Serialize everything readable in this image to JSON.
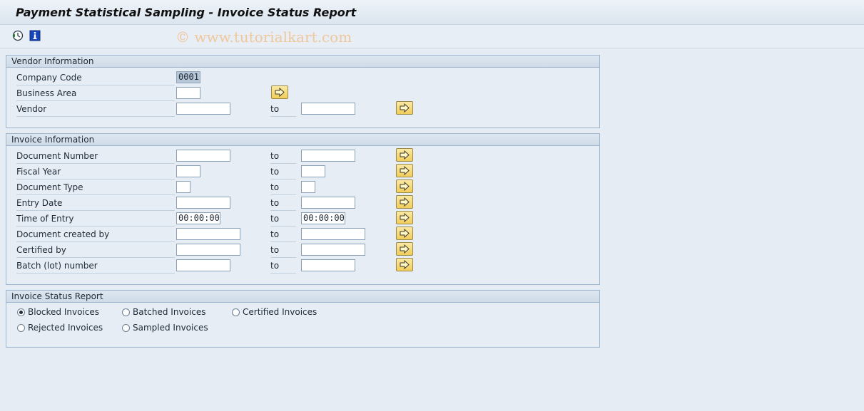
{
  "window": {
    "title": "Payment Statistical Sampling - Invoice Status Report",
    "watermark": "© www.tutorialkart.com"
  },
  "toolbar": {
    "buttons": [
      {
        "icon": "execute-clock-icon"
      },
      {
        "icon": "info-icon"
      }
    ]
  },
  "vendor_info": {
    "header": "Vendor Information",
    "fields": [
      {
        "label": "Company Code",
        "value": "0001",
        "readonly": true
      },
      {
        "label": "Business Area",
        "value": ""
      },
      {
        "label": "Vendor",
        "value": "",
        "to_label": "to",
        "to_value": ""
      }
    ]
  },
  "invoice_info": {
    "header": "Invoice Information",
    "fields": [
      {
        "label": "Document Number",
        "value": "",
        "to_label": "to",
        "to_value": ""
      },
      {
        "label": "Fiscal Year",
        "value": "",
        "to_label": "to",
        "to_value": ""
      },
      {
        "label": "Document Type",
        "value": "",
        "to_label": "to",
        "to_value": ""
      },
      {
        "label": "Entry Date",
        "value": "",
        "to_label": "to",
        "to_value": ""
      },
      {
        "label": "Time of Entry",
        "value": "00:00:00",
        "to_label": "to",
        "to_value": "00:00:00"
      },
      {
        "label": "Document created by",
        "value": "",
        "to_label": "to",
        "to_value": ""
      },
      {
        "label": "Certified by",
        "value": "",
        "to_label": "to",
        "to_value": ""
      },
      {
        "label": "Batch (lot) number",
        "value": "",
        "to_label": "to",
        "to_value": ""
      }
    ]
  },
  "status_report": {
    "header": "Invoice Status Report",
    "options": [
      {
        "label": "Blocked Invoices",
        "selected": true
      },
      {
        "label": "Batched Invoices",
        "selected": false
      },
      {
        "label": "Certified Invoices",
        "selected": false
      },
      {
        "label": "Rejected Invoices",
        "selected": false
      },
      {
        "label": "Sampled Invoices",
        "selected": false
      }
    ]
  },
  "colors": {
    "background": "#e5ecf4",
    "multi_select_button": "#f2cd5a",
    "watermark": "#f0c79c"
  }
}
